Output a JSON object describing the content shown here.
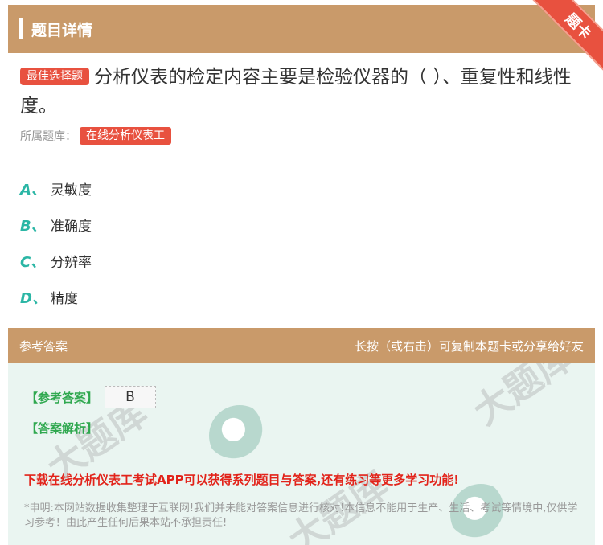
{
  "header": {
    "title": "题目详情",
    "ribbon": "题卡"
  },
  "question": {
    "type_badge": "最佳选择题",
    "text": "分析仪表的检定内容主要是检验仪器的（ ）、重复性和线性度。",
    "bank_label": "所属题库：",
    "bank_name": "在线分析仪表工"
  },
  "options": [
    {
      "letter": "A、",
      "text": "灵敏度"
    },
    {
      "letter": "B、",
      "text": "准确度"
    },
    {
      "letter": "C、",
      "text": "分辨率"
    },
    {
      "letter": "D、",
      "text": "精度"
    }
  ],
  "answer_bar": {
    "left": "参考答案",
    "right": "长按（或右击）可复制本题卡或分享给好友"
  },
  "answer": {
    "ref_label": "【参考答案】",
    "value": "B",
    "explain_label": "【答案解析】",
    "download_note": "下载在线分析仪表工考试APP可以获得系列题目与答案,还有练习等更多学习功能!",
    "disclaimer": "*申明:本网站数据收集整理于互联网!我们并未能对答案信息进行核对!本信息不能用于生产、生活、考试等情境中,仅供学习参考！由此产生任何后果本站不承担责任!"
  },
  "colors": {
    "accent_bar": "#c99a6a",
    "badge_red": "#e8513f",
    "option_letter": "#2bb6a5",
    "answer_green": "#2fa84f",
    "note_red": "#e2231a"
  }
}
